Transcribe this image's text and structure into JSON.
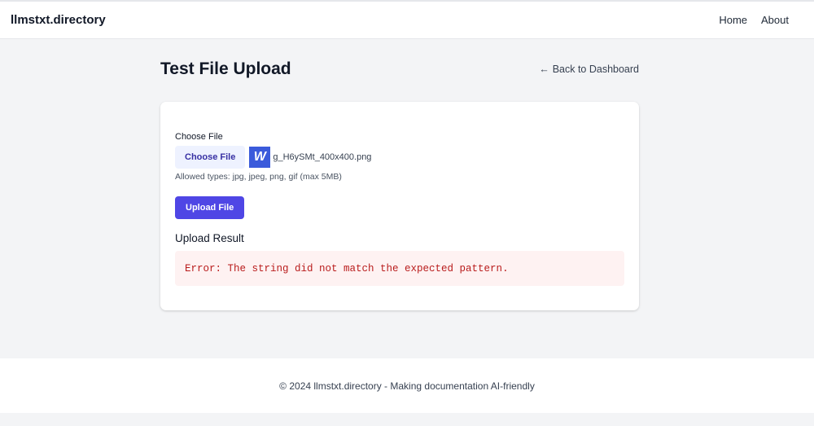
{
  "header": {
    "brand": "llmstxt.directory",
    "nav": [
      "Home",
      "About"
    ]
  },
  "page": {
    "title": "Test File Upload",
    "back_arrow": "←",
    "back_label": "Back to Dashboard"
  },
  "form": {
    "file_label": "Choose File",
    "choose_button": "Choose File",
    "thumb_icon": "W",
    "file_name": "g_H6ySMt_400x400.png",
    "hint": "Allowed types: jpg, jpeg, png, gif (max 5MB)",
    "upload_button": "Upload File"
  },
  "result": {
    "heading": "Upload Result",
    "error": "Error: The string did not match the expected pattern."
  },
  "footer": {
    "text": "© 2024 llmstxt.directory - Making documentation AI-friendly"
  },
  "colors": {
    "primary": "#4f46e5",
    "error_text": "#b91c1c",
    "error_bg": "#fef2f2"
  }
}
